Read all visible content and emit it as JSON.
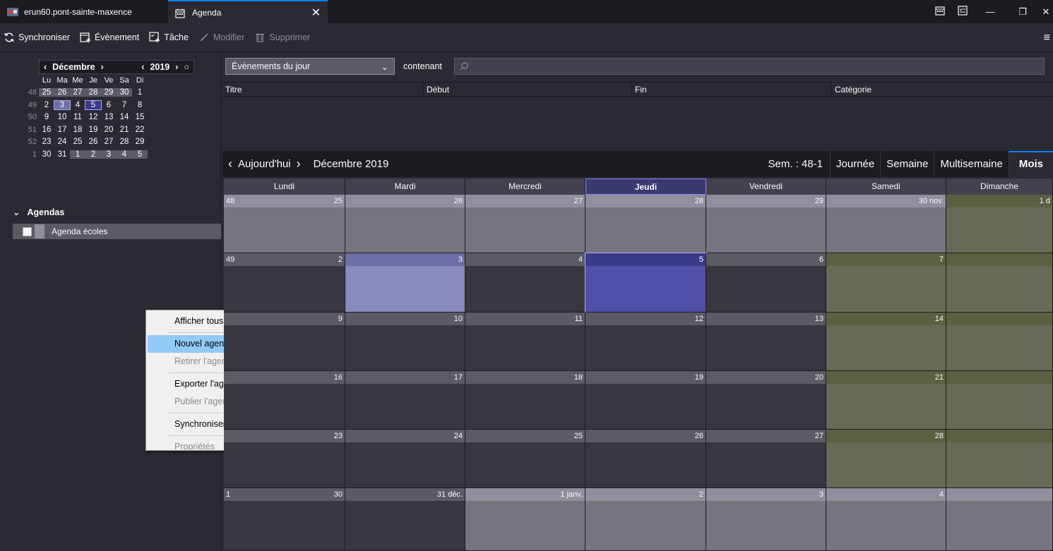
{
  "tabs": [
    {
      "label": "erun60.pont-sainte-maxence"
    },
    {
      "label": "Agenda"
    }
  ],
  "toolbar": {
    "sync": "Synchroniser",
    "event": "Évènement",
    "task": "Tâche",
    "edit": "Modifier",
    "delete": "Supprimer"
  },
  "minical": {
    "month": "Décembre",
    "year": "2019",
    "weekdays": [
      "Lu",
      "Ma",
      "Me",
      "Je",
      "Ve",
      "Sa",
      "Di"
    ],
    "weeks": [
      {
        "num": "48",
        "days": [
          "25",
          "26",
          "27",
          "28",
          "29",
          "30",
          "1"
        ]
      },
      {
        "num": "49",
        "days": [
          "2",
          "3",
          "4",
          "5",
          "6",
          "7",
          "8"
        ]
      },
      {
        "num": "50",
        "days": [
          "9",
          "10",
          "11",
          "12",
          "13",
          "14",
          "15"
        ]
      },
      {
        "num": "51",
        "days": [
          "16",
          "17",
          "18",
          "19",
          "20",
          "21",
          "22"
        ]
      },
      {
        "num": "52",
        "days": [
          "23",
          "24",
          "25",
          "26",
          "27",
          "28",
          "29"
        ]
      },
      {
        "num": "1",
        "days": [
          "30",
          "31",
          "1",
          "2",
          "3",
          "4",
          "5"
        ]
      }
    ]
  },
  "agendas": {
    "heading": "Agendas",
    "items": [
      {
        "label": "Agenda écoles"
      }
    ]
  },
  "context_menu": [
    {
      "label": "Afficher tous les agendas"
    },
    {
      "label": "Nouvel agenda..."
    },
    {
      "label": "Retirer l'agenda..."
    },
    {
      "label": "Exporter l'agenda..."
    },
    {
      "label": "Publier l'agenda..."
    },
    {
      "label": "Synchroniser les agendas"
    },
    {
      "label": "Propriétés"
    }
  ],
  "filter": {
    "selected": "Évènements du jour",
    "containing": "contenant",
    "search_placeholder": ""
  },
  "list_columns": [
    "Titre",
    "Début",
    "Fin",
    "Catégorie"
  ],
  "nav": {
    "today": "Aujourd'hui",
    "title": "Décembre 2019",
    "week": "Sem. : 48-1",
    "views": [
      "Journée",
      "Semaine",
      "Multisemaine",
      "Mois"
    ]
  },
  "month": {
    "day_headers": [
      "Lundi",
      "Mardi",
      "Mercredi",
      "Jeudi",
      "Vendredi",
      "Samedi",
      "Dimanche"
    ],
    "weeks": [
      {
        "num": "48",
        "days": [
          "25",
          "26",
          "27",
          "28",
          "29",
          "30 nov.",
          "1 d"
        ]
      },
      {
        "num": "49",
        "days": [
          "2",
          "3",
          "4",
          "5",
          "6",
          "7",
          ""
        ]
      },
      {
        "num": "",
        "days": [
          "9",
          "10",
          "11",
          "12",
          "13",
          "14",
          ""
        ]
      },
      {
        "num": "",
        "days": [
          "16",
          "17",
          "18",
          "19",
          "20",
          "21",
          ""
        ]
      },
      {
        "num": "",
        "days": [
          "23",
          "24",
          "25",
          "26",
          "27",
          "28",
          ""
        ]
      },
      {
        "num": "1",
        "days": [
          "30",
          "31 déc.",
          "1 janv.",
          "2",
          "3",
          "4",
          ""
        ]
      }
    ]
  }
}
